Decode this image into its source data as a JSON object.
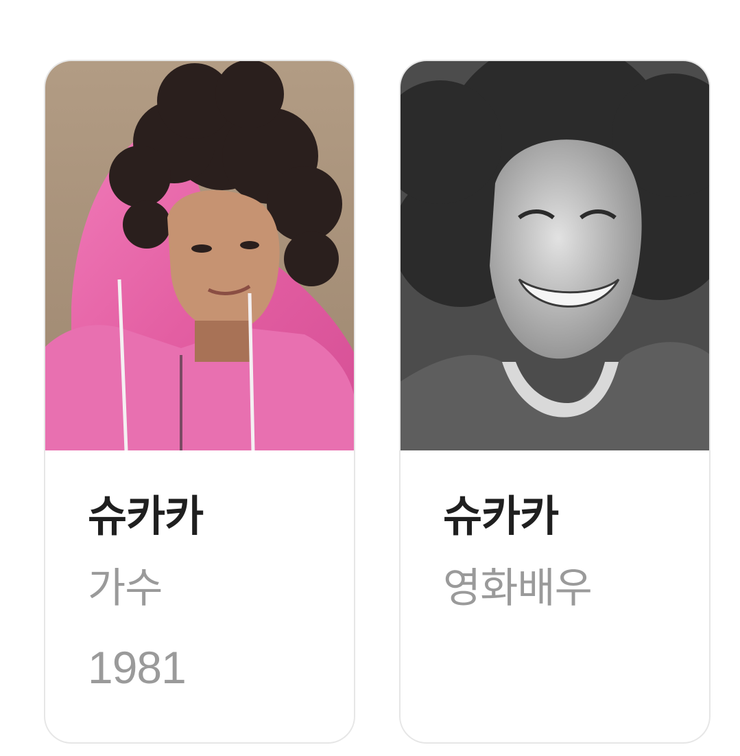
{
  "cards": [
    {
      "name": "슈카카",
      "occupation": "가수",
      "year": "1981",
      "photo_alt": "portrait-pink-hoodie"
    },
    {
      "name": "슈카카",
      "occupation": "영화배우",
      "photo_alt": "portrait-bw-afro"
    }
  ],
  "colors": {
    "card_border": "#e6e6e6",
    "name_text": "#1f1f1f",
    "meta_text": "#9a9a9a",
    "hoodie_pink": "#e564a6",
    "photo_bg_tan": "#a9947d"
  }
}
